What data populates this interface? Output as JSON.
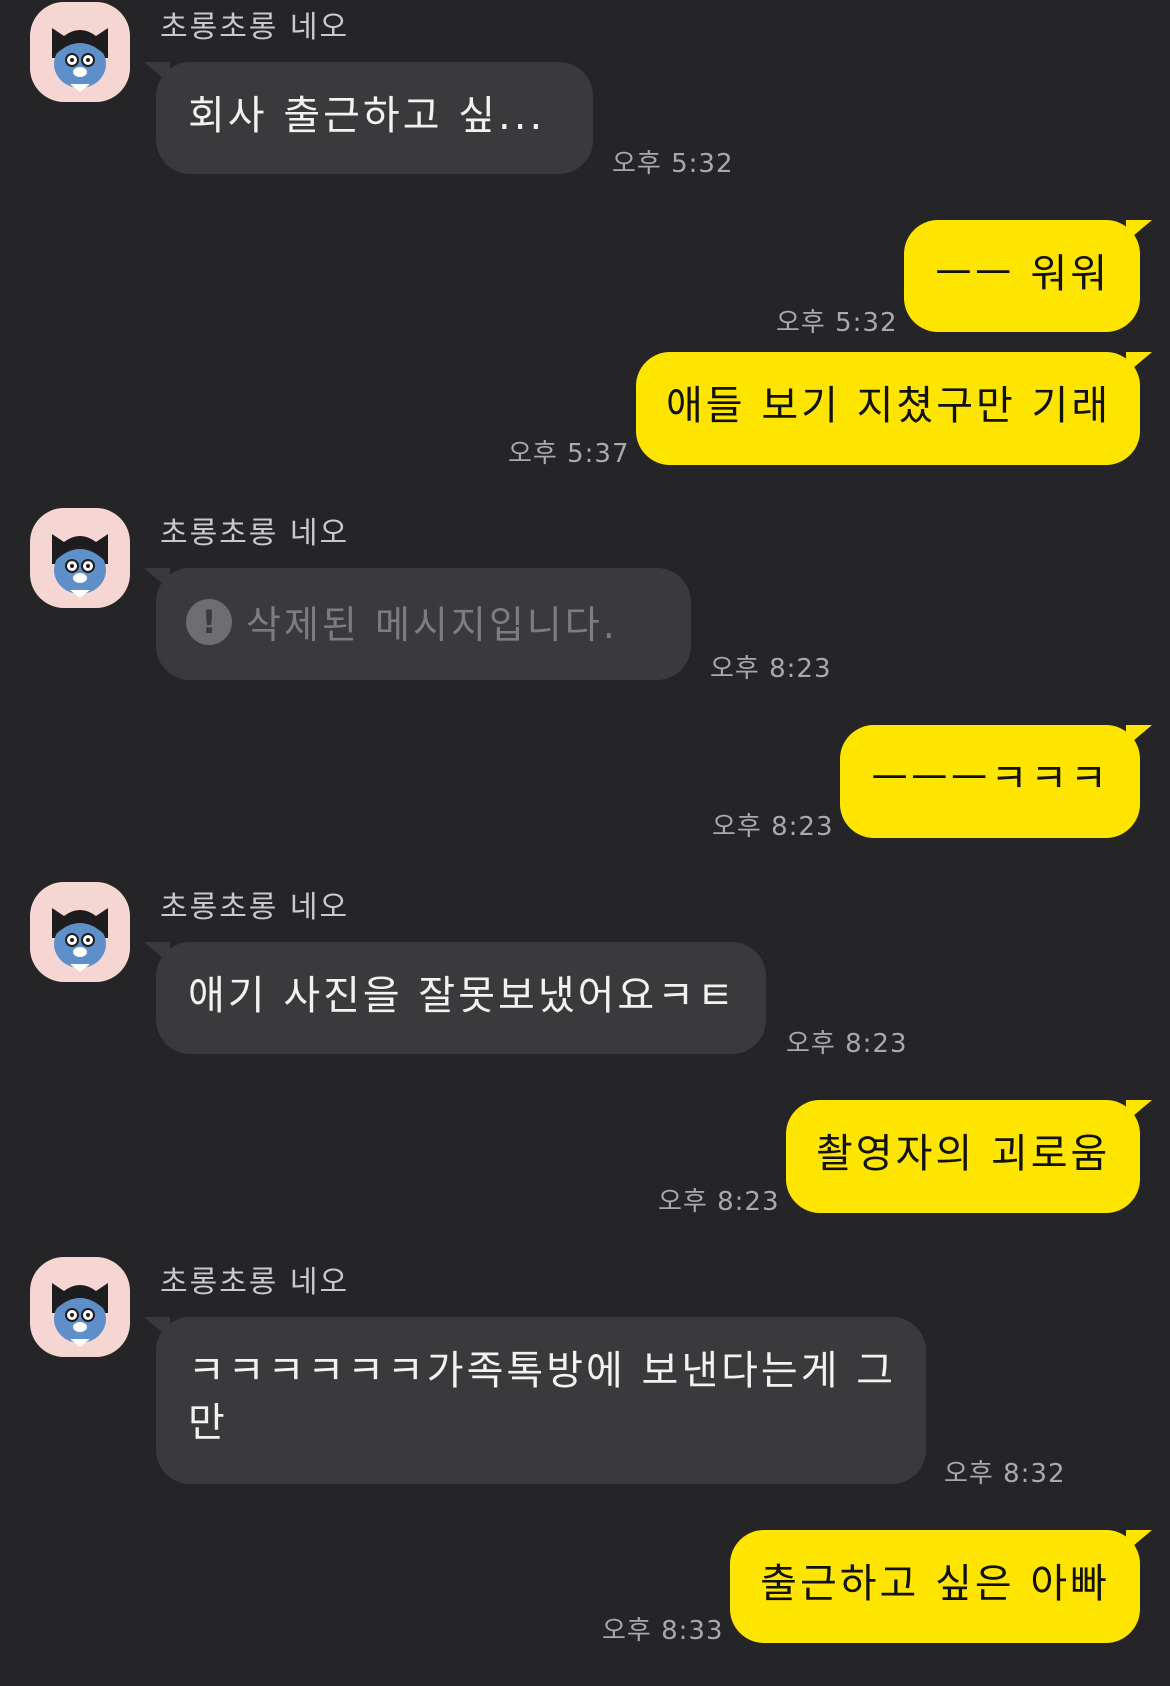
{
  "colors": {
    "background": "#252528",
    "incoming_bubble": "#3a3a3d",
    "outgoing_bubble": "#fee500",
    "timestamp": "#a9a9ad",
    "sender_name": "#c9c9cc"
  },
  "messages": [
    {
      "sender": "초롱초롱 네오",
      "text": "회사 출근하고 싶...",
      "time": "오후 5:32",
      "avatar_icon": "neo-character-avatar-icon"
    },
    {
      "text": "ㅡㅡ 워워",
      "time": "오후 5:32"
    },
    {
      "text": "애들 보기 지쳤구만 기래",
      "time": "오후 5:37"
    },
    {
      "sender": "초롱초롱 네오",
      "text": "삭제된 메시지입니다.",
      "time": "오후 8:23",
      "status_icon": "exclamation-icon",
      "avatar_icon": "neo-character-avatar-icon"
    },
    {
      "text": "ㅡㅡㅡㅋㅋㅋ",
      "time": "오후 8:23"
    },
    {
      "sender": "초롱초롱 네오",
      "text": "애기 사진을 잘못보냈어요ㅋㅌ",
      "time": "오후 8:23",
      "avatar_icon": "neo-character-avatar-icon"
    },
    {
      "text": "촬영자의 괴로움",
      "time": "오후 8:23"
    },
    {
      "sender": "초롱초롱 네오",
      "text_line1": "ㅋㅋㅋㅋㅋㅋ가족톡방에 보낸다는게 그",
      "text_line2": "만",
      "time": "오후 8:32",
      "avatar_icon": "neo-character-avatar-icon"
    },
    {
      "text": "출근하고 싶은 아빠",
      "time": "오후 8:33"
    }
  ]
}
